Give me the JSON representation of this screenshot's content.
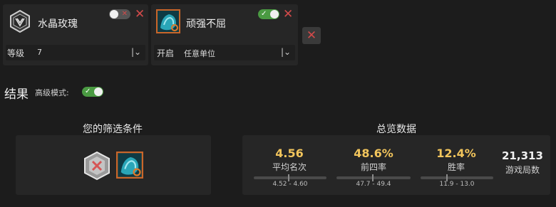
{
  "filters": [
    {
      "name": "水晶玫瑰",
      "icon": "crystal-rose-emblem-icon",
      "toggle_state": "off",
      "select_label": "等级",
      "select_value": "7"
    },
    {
      "name": "顽强不屈",
      "icon": "unyielding-portrait-icon",
      "toggle_state": "on",
      "select_label": "开启",
      "select_value": "任意单位"
    }
  ],
  "results": {
    "title": "结果",
    "advanced_mode_label": "高级模式:",
    "advanced_mode": "on"
  },
  "conditions_panel": {
    "title": "您的筛选条件",
    "icons": [
      "crystal-rose-disabled-icon",
      "unyielding-portrait-icon"
    ]
  },
  "overview_panel": {
    "title": "总览数据",
    "stats": [
      {
        "value": "4.56",
        "label": "平均名次",
        "range": "4.52 - 4.60"
      },
      {
        "value": "48.6%",
        "label": "前四率",
        "range": "47.7 - 49.4"
      },
      {
        "value": "12.4%",
        "label": "胜率",
        "range": "11.9 - 13.0"
      }
    ],
    "games": {
      "value": "21,313",
      "label": "游戏局数"
    }
  },
  "colors": {
    "background": "#1c1c1c",
    "card": "#262626",
    "accent_value": "#f2c55c",
    "toggle_on": "#4a9a42",
    "remove_red": "#d24a4a"
  }
}
